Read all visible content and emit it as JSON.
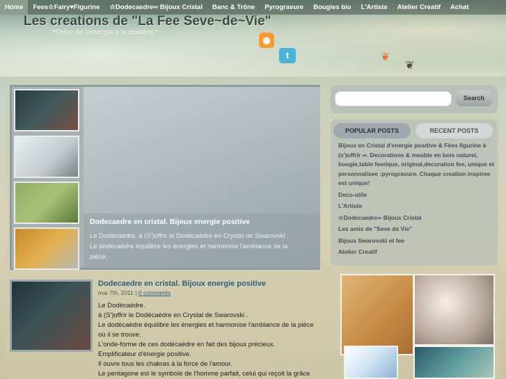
{
  "nav": {
    "items": [
      "Home",
      "Fees☆Fairy♥Figurine",
      "☆Dodecaedre∞ Bijoux Cristal",
      "Banc & Trône",
      "Pyrogravure",
      "Bougies bio",
      "L'Artiste",
      "Atelier Creatif",
      "Achat"
    ]
  },
  "header": {
    "title": "Les creations de \"La Fee Seve~de~Vie\"",
    "tagline": "*Créer de l'énergie à la matière *",
    "rss_icon": "rss-icon",
    "twitter_icon": "twitter-icon"
  },
  "slider": {
    "title": "Dodecaedre en cristal. Bijoux energie positive",
    "desc_line1": "Le Dodécaèdre. à (S')offrir le Dodécaèdre en Crystal de Swarovski .",
    "desc_line2": "Le dodécaèdre équilibre les énergies et harmonise l'ambiance de la",
    "desc_line3": "pièce."
  },
  "post": {
    "title": "Dodecaedre en cristal. Bijoux energie positive",
    "date": "mai 7th, 2011",
    "sep": "|",
    "comments": "0 comments",
    "lines": [
      "Le Dodécaèdre.",
      "à (S')offrir le Dodécaèdre en Crystal de Swarovski .",
      "Le dodécaèdre équilibre les énergies et harmonise l'ambiance de la pièce",
      "où il se trouve.",
      "L'onde-forme de ces dodécaèdre en fait des bijoux précieux.",
      "Emplificateur d'énergie positive.",
      "Il ouvre tous les chakras à la force de l'amour.",
      "Le pentagone est le symbole de l'homme parfait, celui qui reçoit la grâce"
    ]
  },
  "sidebar": {
    "search_button": "Search",
    "tab_popular": "POPULAR POSTS",
    "tab_recent": "RECENT POSTS",
    "popular": [
      "Bijoux en Cristal d'energie positive & Fées figurine à (s')offrir ∞. Decorations & meuble en bois naturel, bougie,table feerique, original,decoration fee, unique et personnalisee :pyrogravure. Chaque creation inspiree est unique!",
      "Deco-utile",
      "L'Artiste",
      "☆Dodecaedre∞ Bijoux Cristal",
      "Les amis de \"Seve de Vie\"",
      "Bijoux Swarovski et fee",
      "Atelier Creatif"
    ]
  }
}
